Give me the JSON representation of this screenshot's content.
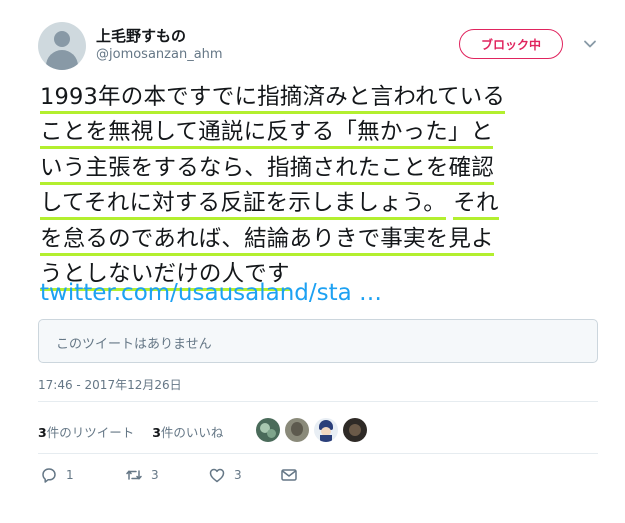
{
  "user": {
    "display_name": "上毛野すもの",
    "handle": "@jomosanzan_ahm",
    "avatar_icon": "default-avatar-icon"
  },
  "header": {
    "block_label": "ブロック中",
    "menu_icon": "chevron-down-icon"
  },
  "tweet": {
    "lines": [
      "1993年の本ですでに指摘済みと言われている",
      "ことを無視して通説に反する「無かった」と",
      "いう主張をするなら、指摘されたことを確認",
      "してそれに対する反証を示しましょう。",
      "それ",
      "を怠るのであれば、結論ありきで事実を見よ",
      "うとしないだけの人です"
    ],
    "link": "twitter.com/usausaland/sta …",
    "highlight_color": "#b3ef2f"
  },
  "quoted_tweet": {
    "unavailable_text": "このツイートはありません"
  },
  "timestamp": "17:46 - 2017年12月26日",
  "stats": {
    "retweet_count": "3",
    "retweet_label": "件のリツイート",
    "like_count": "3",
    "like_label": "件のいいね"
  },
  "actions": {
    "reply_count": "1",
    "retweet_count": "3",
    "like_count": "3"
  },
  "colors": {
    "accent": "#1da1f2",
    "block": "#e0245e",
    "muted": "#657786"
  }
}
